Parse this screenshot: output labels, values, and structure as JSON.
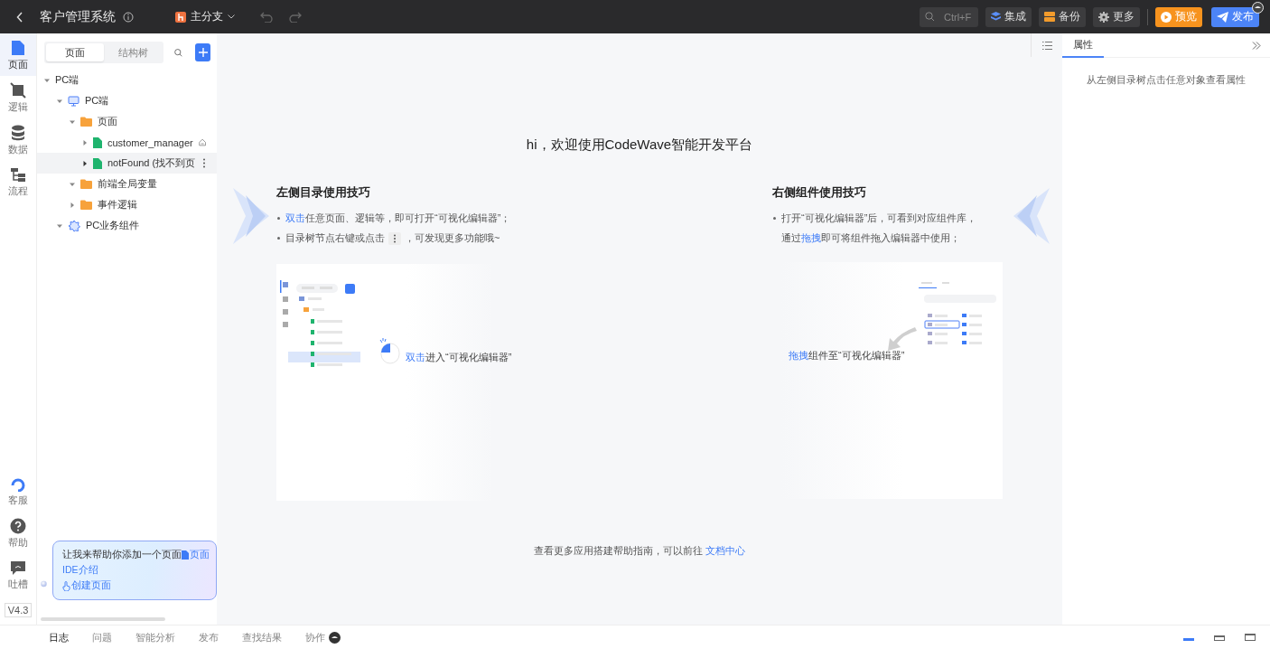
{
  "header": {
    "title": "客户管理系统",
    "branch": "主分支",
    "search_hint": "Ctrl+F",
    "buttons": [
      {
        "label": "集成",
        "kind": "integrate"
      },
      {
        "label": "备份",
        "kind": "backup"
      },
      {
        "label": "更多",
        "kind": "more"
      },
      {
        "label": "预览",
        "kind": "preview"
      },
      {
        "label": "发布",
        "kind": "publish"
      }
    ]
  },
  "rail": {
    "items": [
      {
        "label": "页面",
        "kind": "page",
        "selected": true
      },
      {
        "label": "逻辑",
        "kind": "logic",
        "selected": false
      },
      {
        "label": "数据",
        "kind": "data",
        "selected": false
      },
      {
        "label": "流程",
        "kind": "flow",
        "selected": false
      }
    ],
    "bottom_items": [
      {
        "label": "客服",
        "kind": "service"
      },
      {
        "label": "帮助",
        "kind": "help"
      },
      {
        "label": "吐槽",
        "kind": "feedback"
      }
    ],
    "version": "V4.3"
  },
  "tree_panel": {
    "tabs": [
      {
        "label": "页面",
        "selected": true
      },
      {
        "label": "结构树",
        "selected": false
      }
    ],
    "tree": [
      {
        "label": "PC端",
        "expanded": true,
        "selected": false,
        "children": [
          {
            "label": "PC端",
            "kind": "monitor",
            "expanded": true,
            "selected": false,
            "children": [
              {
                "label": "页面",
                "kind": "folder",
                "expanded": true,
                "selected": false,
                "children": [
                  {
                    "label": "customer_manager",
                    "kind": "page",
                    "expanded": false,
                    "selected": false,
                    "home": true
                  },
                  {
                    "label": "notFound (找不到页",
                    "kind": "page",
                    "expanded": false,
                    "selected": true,
                    "home": false
                  }
                ]
              },
              {
                "label": "前端全局变量",
                "kind": "folder",
                "expanded": true,
                "selected": false
              },
              {
                "label": "事件逻辑",
                "kind": "folder",
                "expanded": false,
                "selected": false
              }
            ]
          },
          {
            "label": "PC业务组件",
            "kind": "component",
            "expanded": true,
            "selected": false
          }
        ]
      }
    ]
  },
  "welcome": {
    "title": "hi，欢迎使用CodeWave智能开发平台",
    "left": {
      "title": "左侧目录使用技巧",
      "tips": [
        [
          {
            "kind": "highlight",
            "text": "双击"
          },
          {
            "kind": "text",
            "text": "任意页面、逻辑等，即可打开“可视化编辑器”；"
          }
        ],
        [
          {
            "kind": "text",
            "text": "目录树节点右键或点击"
          },
          {
            "kind": "more-icon"
          },
          {
            "kind": "text",
            "text": "，可发现更多功能哦~"
          }
        ]
      ],
      "caption": [
        {
          "kind": "highlight",
          "text": "双击"
        },
        {
          "kind": "text",
          "text": "进入“可视化编辑器”"
        }
      ]
    },
    "right": {
      "title": "右侧组件使用技巧",
      "tips": [
        [
          {
            "kind": "text",
            "text": "打开“可视化编辑器”后，可看到对应组件库，"
          },
          {
            "kind": "break"
          },
          {
            "kind": "text",
            "text": "通过"
          },
          {
            "kind": "highlight",
            "text": "拖拽"
          },
          {
            "kind": "text",
            "text": "即可将组件拖入编辑器中使用；"
          }
        ]
      ],
      "caption": [
        {
          "kind": "highlight",
          "text": "拖拽"
        },
        {
          "kind": "text",
          "text": "组件至“可视化编辑器”"
        }
      ]
    },
    "footer": {
      "text": "查看更多应用搭建帮助指南，可以前往",
      "link": "文档中心"
    }
  },
  "assistant": {
    "message": "让我来帮助你添加一个页面",
    "tag": "页面",
    "intro_link": "IDE介绍",
    "action": "创建页面"
  },
  "properties": {
    "tab": "属性",
    "hint": "从左侧目录树点击任意对象查看属性"
  },
  "bottom_bar": {
    "tabs": [
      {
        "label": "日志",
        "selected": true,
        "badge": false
      },
      {
        "label": "问题",
        "selected": false,
        "badge": false
      },
      {
        "label": "智能分析",
        "selected": false,
        "badge": false
      },
      {
        "label": "发布",
        "selected": false,
        "badge": false
      },
      {
        "label": "查找结果",
        "selected": false,
        "badge": false
      },
      {
        "label": "协作",
        "selected": false,
        "badge": true
      }
    ],
    "layouts": [
      {
        "selected": true
      },
      {
        "selected": false
      },
      {
        "selected": false
      }
    ]
  }
}
